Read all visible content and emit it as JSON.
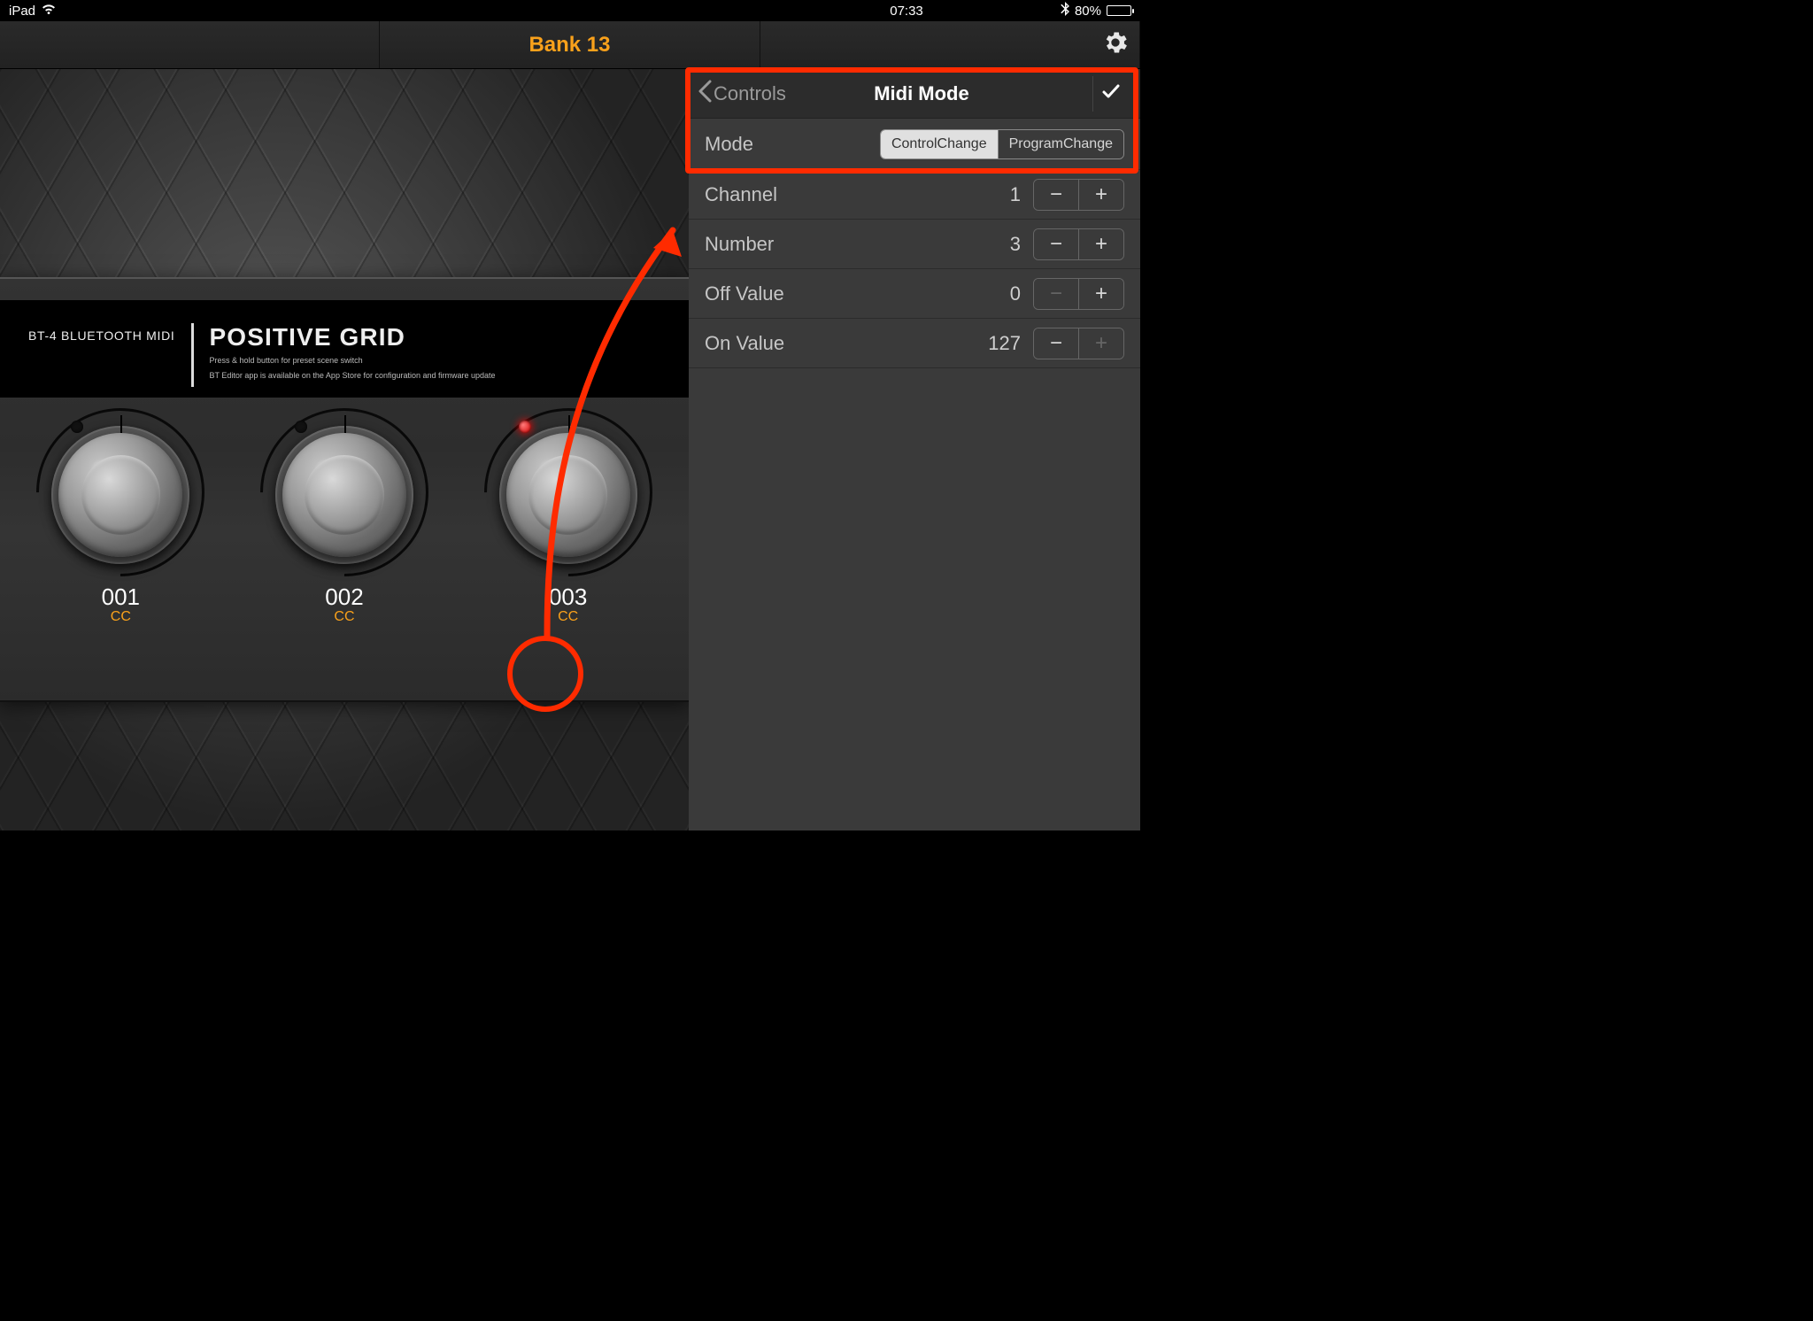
{
  "statusbar": {
    "device": "iPad",
    "time": "07:33",
    "battery_pct": "80%"
  },
  "titlebar": {
    "title": "Bank 13"
  },
  "pedal": {
    "model": "BT-4 BLUETOOTH MIDI",
    "brand": "POSITIVE GRID",
    "sub1": "Press & hold button for preset scene switch",
    "sub2": "BT Editor app is available on the App Store for configuration and firmware update",
    "knobs": [
      {
        "num": "001",
        "type": "CC",
        "active": false
      },
      {
        "num": "002",
        "type": "CC",
        "active": false
      },
      {
        "num": "003",
        "type": "CC",
        "active": true
      }
    ]
  },
  "panel": {
    "back_label": "Controls",
    "title": "Midi Mode",
    "mode_label": "Mode",
    "mode_options": {
      "a": "ControlChange",
      "b": "ProgramChange"
    },
    "rows": [
      {
        "label": "Channel",
        "value": "1",
        "minus_disabled": false,
        "plus_disabled": false
      },
      {
        "label": "Number",
        "value": "3",
        "minus_disabled": false,
        "plus_disabled": false
      },
      {
        "label": "Off Value",
        "value": "0",
        "minus_disabled": true,
        "plus_disabled": false
      },
      {
        "label": "On Value",
        "value": "127",
        "minus_disabled": false,
        "plus_disabled": true
      }
    ]
  }
}
